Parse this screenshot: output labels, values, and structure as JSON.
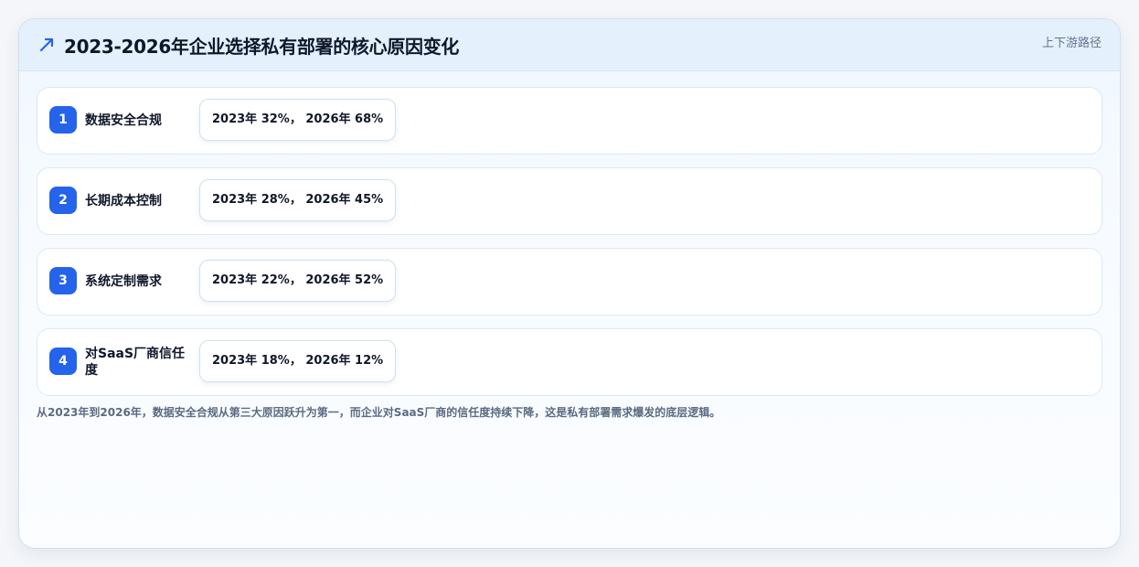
{
  "header": {
    "title": "2023-2026年企业选择私有部署的核心原因变化",
    "tag": "上下游路径",
    "icon": "trending-up-icon",
    "accent_color": "#2563eb"
  },
  "items": [
    {
      "index": "1",
      "label": "数据安全合规",
      "value": "2023年 32%， 2026年 68%"
    },
    {
      "index": "2",
      "label": "长期成本控制",
      "value": "2023年 28%， 2026年 45%"
    },
    {
      "index": "3",
      "label": "系统定制需求",
      "value": "2023年 22%， 2026年 52%"
    },
    {
      "index": "4",
      "label": "对SaaS厂商信任度",
      "value": "2023年 18%， 2026年 12%"
    }
  ],
  "note": "从2023年到2026年，数据安全合规从第三大原因跃升为第一，而企业对SaaS厂商的信任度持续下降，这是私有部署需求爆发的底层逻辑。"
}
